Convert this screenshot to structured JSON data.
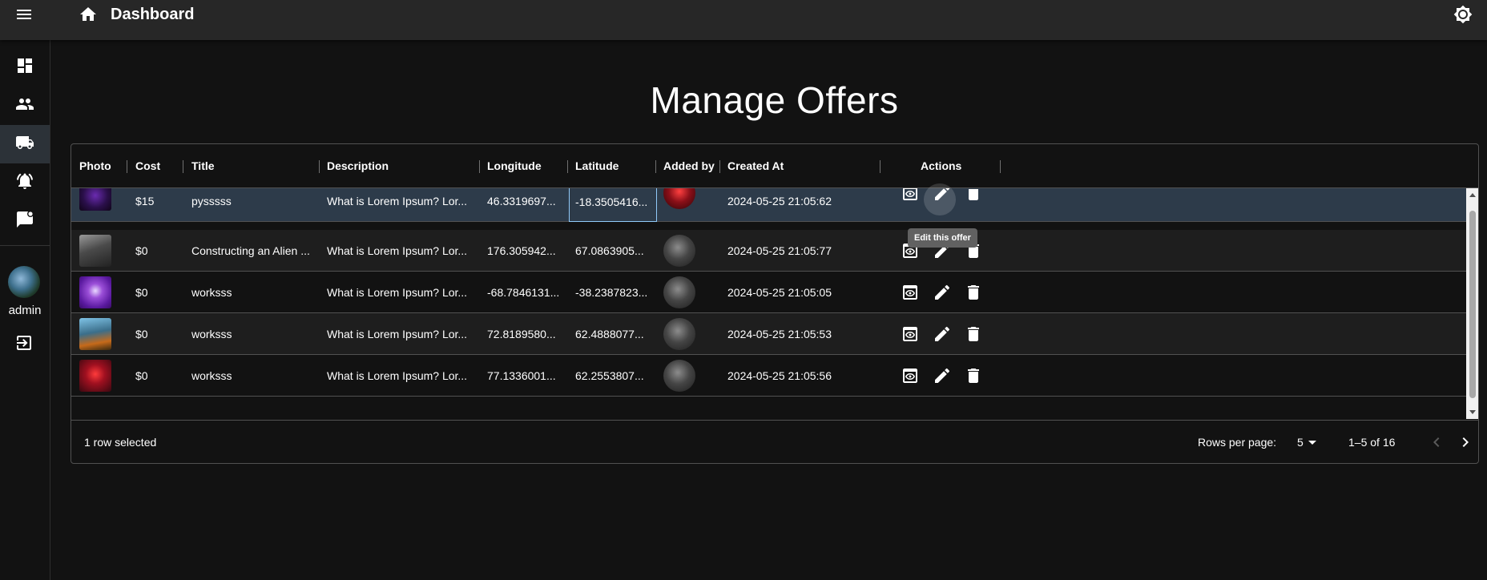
{
  "header": {
    "app_title": "Dashboard",
    "menu_icon": "menu-icon",
    "home_icon": "home-icon",
    "theme_icon": "brightness-icon"
  },
  "sidebar": {
    "items": [
      {
        "name": "dashboard",
        "icon": "dashboard-icon"
      },
      {
        "name": "users",
        "icon": "group-icon"
      },
      {
        "name": "offers",
        "icon": "truck-icon",
        "active": true
      },
      {
        "name": "notifications",
        "icon": "alarm-icon"
      },
      {
        "name": "messages",
        "icon": "chat-icon"
      }
    ],
    "user_label": "admin",
    "logout_icon": "logout-icon"
  },
  "page": {
    "title": "Manage Offers"
  },
  "table": {
    "columns": [
      "Photo",
      "Cost",
      "Title",
      "Description",
      "Longitude",
      "Latitude",
      "Added by",
      "Created At",
      "Actions"
    ],
    "rows": [
      {
        "cost": "$15",
        "title": "pysssss",
        "description": "What is Lorem Ipsum? Lor...",
        "longitude": "46.3319697...",
        "latitude": "-18.3505416...",
        "created_at": "2024-05-25 21:05:62",
        "selected": true
      },
      {
        "cost": "$0",
        "title": "Constructing an Alien ...",
        "description": "What is Lorem Ipsum? Lor...",
        "longitude": "176.305942...",
        "latitude": "67.0863905...",
        "created_at": "2024-05-25 21:05:77"
      },
      {
        "cost": "$0",
        "title": "worksss",
        "description": "What is Lorem Ipsum? Lor...",
        "longitude": "-68.7846131...",
        "latitude": "-38.2387823...",
        "created_at": "2024-05-25 21:05:05"
      },
      {
        "cost": "$0",
        "title": "worksss",
        "description": "What is Lorem Ipsum? Lor...",
        "longitude": "72.8189580...",
        "latitude": "62.4888077...",
        "created_at": "2024-05-25 21:05:53"
      },
      {
        "cost": "$0",
        "title": "worksss",
        "description": "What is Lorem Ipsum? Lor...",
        "longitude": "77.1336001...",
        "latitude": "62.2553807...",
        "created_at": "2024-05-25 21:05:56"
      }
    ],
    "action_icons": [
      "view-icon",
      "edit-icon",
      "delete-icon"
    ],
    "tooltip": "Edit this offer"
  },
  "footer": {
    "selection_text": "1 row selected",
    "rows_per_page_label": "Rows per page:",
    "rows_per_page_value": "5",
    "range_text": "1–5 of 16"
  }
}
